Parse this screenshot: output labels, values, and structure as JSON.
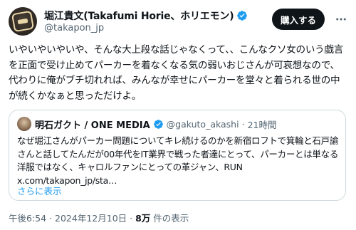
{
  "post": {
    "author": {
      "display_name": "堀江貴文(Takafumi Horie、ホリエモン)",
      "handle": "@takapon_jp",
      "verified": true
    },
    "buy_button_label": "購入する",
    "more_icon": "more-dots-icon",
    "text": "いやいやいやいや、そんな大上段な話じゃなくって、、こんなクソ女のいう戯言を正面で受け止めてパーカーを着なくなる気の弱いおじさんが可哀想なので、代わりに俺がブチ切れれば、みんなが幸せにパーカーを堂々と着られる世の中が続くかなぁと思っただけよ。",
    "quote": {
      "author": {
        "display_name": "明石ガクト / ONE MEDIA",
        "handle": "@gakuto_akashi",
        "separator": "·",
        "time": "21時間",
        "verified": true
      },
      "text": "なぜ堀江さんがパーカー問題についてキレ続けるのかを新宿ロフトで箕輪と石戸諭さんと話してたんだが00年代をIT業界で戦った者達にとって、パーカーとは単なる洋服ではなく、キャロルファンにとっての革ジャン、RUN x.com/takapon_jp/sta…",
      "show_more_label": "さらに表示"
    },
    "meta": {
      "time": "午後6:54",
      "separator": "·",
      "date": "2024年12月10日",
      "views_count": "8万",
      "views_label": "件の表示"
    }
  },
  "colors": {
    "verified_badge": "#1d9bf0",
    "link": "#1d9bf0",
    "secondary_text": "#536471",
    "primary_text": "#0f1419",
    "border": "#cfd9de"
  }
}
